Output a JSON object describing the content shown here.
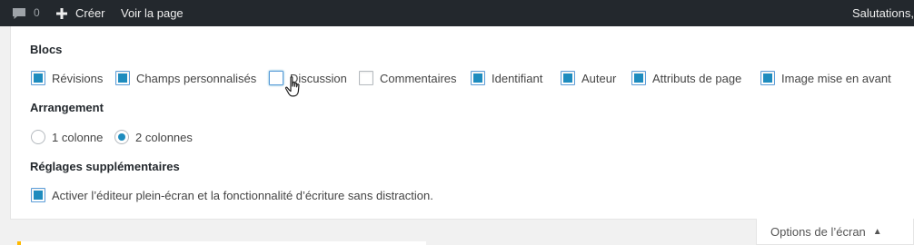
{
  "adminbar": {
    "comments_count": "0",
    "new_label": "Créer",
    "view_label": "Voir la page",
    "greeting": "Salutations,"
  },
  "sections": {
    "blocks_title": "Blocs",
    "arrangement_title": "Arrangement",
    "extra_title": "Réglages supplémentaires"
  },
  "blocks": [
    {
      "label": "Révisions",
      "checked": true
    },
    {
      "label": "Champs personnalisés",
      "checked": true
    },
    {
      "label": "Discussion",
      "checked": false
    },
    {
      "label": "Commentaires",
      "checked": false
    },
    {
      "label": "Identifiant",
      "checked": true
    },
    {
      "label": "Auteur",
      "checked": true
    },
    {
      "label": "Attributs de page",
      "checked": true
    },
    {
      "label": "Image mise en avant",
      "checked": true
    }
  ],
  "arrangement": {
    "one_column": "1 colonne",
    "two_columns": "2 colonnes",
    "selected": "2 colonnes"
  },
  "extra": {
    "dfw_label": "Activer l’éditeur plein-écran et la fonctionnalité d’écriture sans distraction.",
    "dfw_checked": true
  },
  "screen_options_tab": "Options de l’écran",
  "colors": {
    "adminbar": "#23282d",
    "accent": "#1e8cbe"
  }
}
